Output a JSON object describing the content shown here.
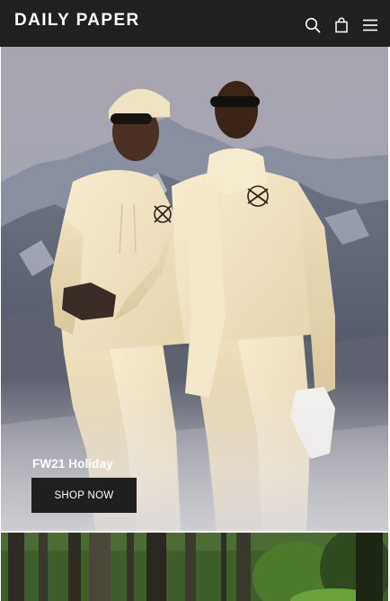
{
  "header": {
    "logo": "DAILY PAPER",
    "icons": [
      "search-icon",
      "bag-icon",
      "menu-icon"
    ]
  },
  "hero": {
    "title": "FW21 Holiday",
    "button_label": "SHOP NOW"
  },
  "colors": {
    "header_bg": "#202020",
    "button_bg": "#1f1f1f",
    "text_light": "#ffffff",
    "garment_cream": "#f2e6c6"
  }
}
